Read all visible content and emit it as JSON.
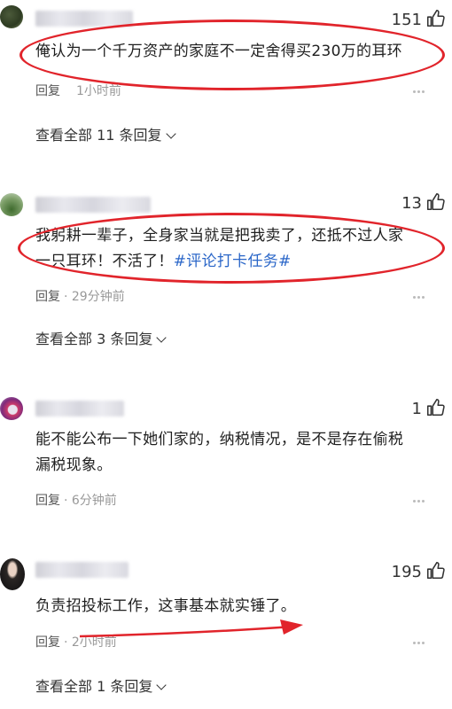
{
  "comments": [
    {
      "likes": "151",
      "text": "俺认为一个千万资产的家庭不一定舍得买230万的耳环",
      "reply": "回复",
      "time": "1小时前",
      "view_all": "查看全部 11 条回复"
    },
    {
      "likes": "13",
      "text": "我躬耕一辈子，全身家当就是把我卖了，还抵不过人家一只耳环！不活了！",
      "hashtag": "#评论打卡任务#",
      "reply": "回复",
      "time": "· 29分钟前",
      "view_all": "查看全部 3 条回复"
    },
    {
      "likes": "1",
      "text": "能不能公布一下她们家的，纳税情况，是不是存在偷税漏税现象。",
      "reply": "回复",
      "time": "· 6分钟前"
    },
    {
      "likes": "195",
      "text": "负责招投标工作，这事基本就实锤了。",
      "reply": "回复",
      "time": "· 2小时前",
      "view_all": "查看全部 1 条回复"
    }
  ],
  "icons": {
    "like": "thumbs-up-icon",
    "more": "more-icon",
    "expand": "chevron-down-icon"
  },
  "annotation_color": "#e1242b"
}
